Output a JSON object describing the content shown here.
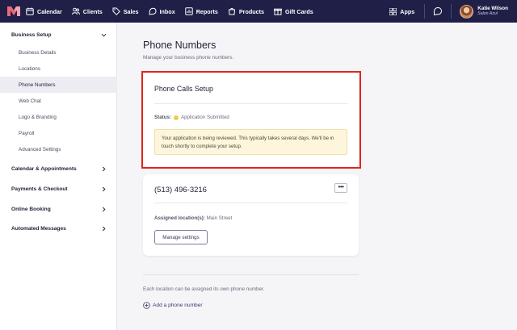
{
  "nav": {
    "items": [
      {
        "label": "Calendar",
        "icon": "calendar-icon"
      },
      {
        "label": "Clients",
        "icon": "clients-icon"
      },
      {
        "label": "Sales",
        "icon": "tag-icon"
      },
      {
        "label": "Inbox",
        "icon": "inbox-icon"
      },
      {
        "label": "Reports",
        "icon": "reports-icon"
      },
      {
        "label": "Products",
        "icon": "products-icon"
      },
      {
        "label": "Gift Cards",
        "icon": "gift-icon"
      }
    ],
    "apps_label": "Apps",
    "user_name": "Katie Wilson",
    "user_business": "Salon Azul",
    "bg_color": "#201f47"
  },
  "sidebar": {
    "business_setup": "Business Setup",
    "items": [
      "Business Details",
      "Locations",
      "Phone Numbers",
      "Web Chat",
      "Logo & Branding",
      "Payroll",
      "Advanced Settings"
    ],
    "active_item": "Phone Numbers",
    "sections": [
      "Calendar & Appointments",
      "Payments & Checkout",
      "Online Booking",
      "Automated Messages"
    ]
  },
  "main": {
    "title": "Phone Numbers",
    "subtitle": "Manage your business phone numbers.",
    "setup_card": {
      "title": "Phone Calls Setup",
      "status_label": "Status:",
      "status_value": "Application Submitted",
      "notice": "Your application is being reviewed. This typically takes several days. We'll be in touch shortly to complete your setup."
    },
    "number_card": {
      "phone": "(513) 496-3216",
      "assigned_label": "Assigned location(s):",
      "assigned_value": "Main Street",
      "manage_label": "Manage settings"
    },
    "footer_note": "Each location can be assigned its own phone number.",
    "add_label": "Add a phone number"
  },
  "colors": {
    "highlight": "#e0251d",
    "status_dot": "#f2c94c",
    "notice_bg": "#fdf6dc"
  }
}
